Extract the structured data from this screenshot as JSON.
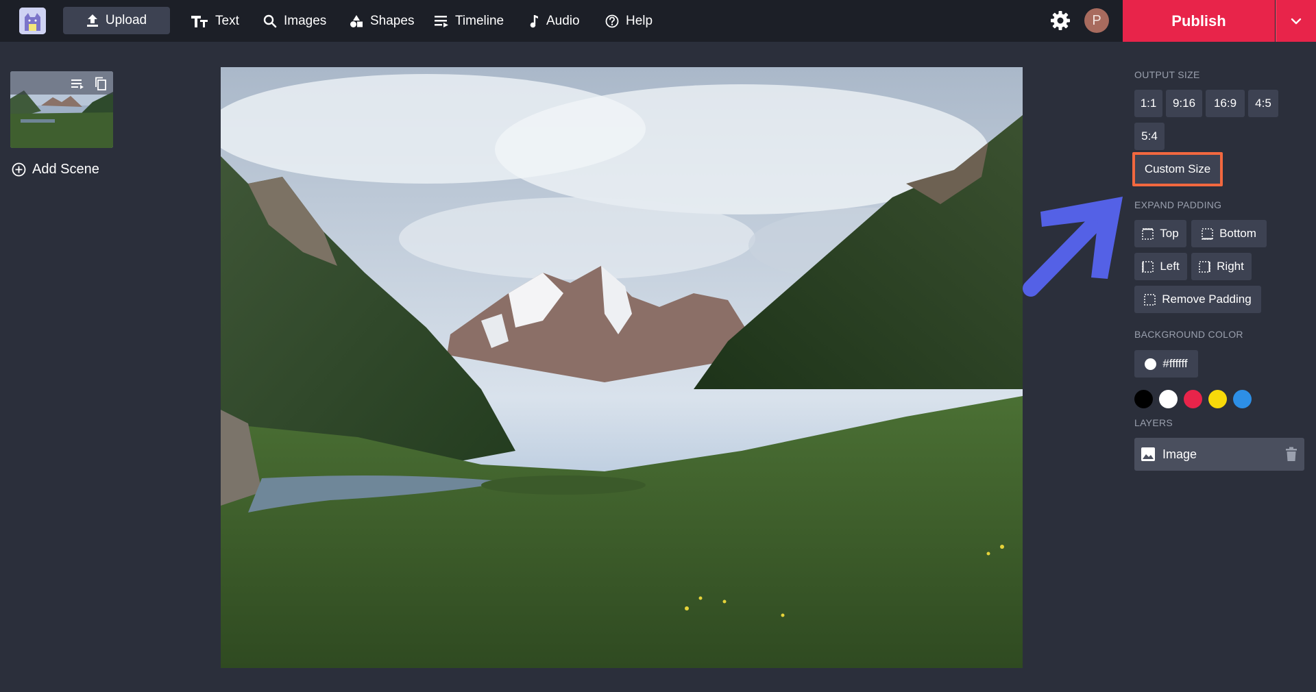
{
  "topbar": {
    "upload_label": "Upload",
    "nav": [
      {
        "label": "Text",
        "icon": "text-icon"
      },
      {
        "label": "Images",
        "icon": "search-icon"
      },
      {
        "label": "Shapes",
        "icon": "shapes-icon"
      },
      {
        "label": "Timeline",
        "icon": "timeline-icon"
      },
      {
        "label": "Audio",
        "icon": "music-note-icon"
      },
      {
        "label": "Help",
        "icon": "help-circle-icon"
      }
    ],
    "avatar_initial": "P",
    "publish_label": "Publish"
  },
  "scenes": {
    "add_scene_label": "Add Scene"
  },
  "panel": {
    "output_size_title": "OUTPUT SIZE",
    "sizes": [
      "1:1",
      "9:16",
      "16:9",
      "4:5",
      "5:4"
    ],
    "custom_size_label": "Custom Size",
    "expand_padding_title": "EXPAND PADDING",
    "padding": {
      "top": "Top",
      "bottom": "Bottom",
      "left": "Left",
      "right": "Right",
      "remove": "Remove Padding"
    },
    "background_color_title": "BACKGROUND COLOR",
    "background_color_value": "#ffffff",
    "swatches": [
      "#000000",
      "#ffffff",
      "#e8244a",
      "#f7d90a",
      "#2d8fe6"
    ],
    "layers_title": "LAYERS",
    "layers": [
      {
        "label": "Image"
      }
    ]
  },
  "colors": {
    "accent": "#e8244a",
    "highlight_outline": "#f2683f",
    "arrow": "#5461e6"
  }
}
